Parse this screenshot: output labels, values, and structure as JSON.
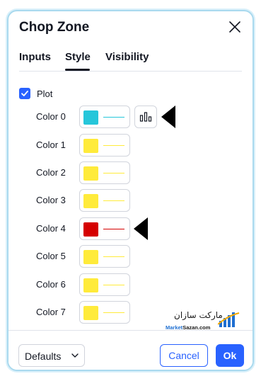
{
  "dialog": {
    "title": "Chop Zone",
    "close_icon": "close-icon"
  },
  "tabs": [
    {
      "label": "Inputs"
    },
    {
      "label": "Style",
      "active": true
    },
    {
      "label": "Visibility"
    }
  ],
  "plot": {
    "label": "Plot",
    "checked": true
  },
  "colors": [
    {
      "label": "Color 0",
      "hex": "#26c6da",
      "has_plot_type_button": true,
      "annotated": true
    },
    {
      "label": "Color 1",
      "hex": "#ffeb3b"
    },
    {
      "label": "Color 2",
      "hex": "#ffeb3b"
    },
    {
      "label": "Color 3",
      "hex": "#ffeb3b"
    },
    {
      "label": "Color 4",
      "hex": "#d50000",
      "annotated": true
    },
    {
      "label": "Color 5",
      "hex": "#ffeb3b"
    },
    {
      "label": "Color 6",
      "hex": "#ffeb3b"
    },
    {
      "label": "Color 7",
      "hex": "#ffeb3b"
    }
  ],
  "watermark": {
    "persian_text": "مارکت سازان",
    "site_text_blue": "Market",
    "site_text_rest": "Sazan.com"
  },
  "footer": {
    "defaults_label": "Defaults",
    "cancel_label": "Cancel",
    "ok_label": "Ok"
  },
  "theme": {
    "accent": "#2962ff",
    "border": "#d1d4dc",
    "text": "#131722"
  }
}
